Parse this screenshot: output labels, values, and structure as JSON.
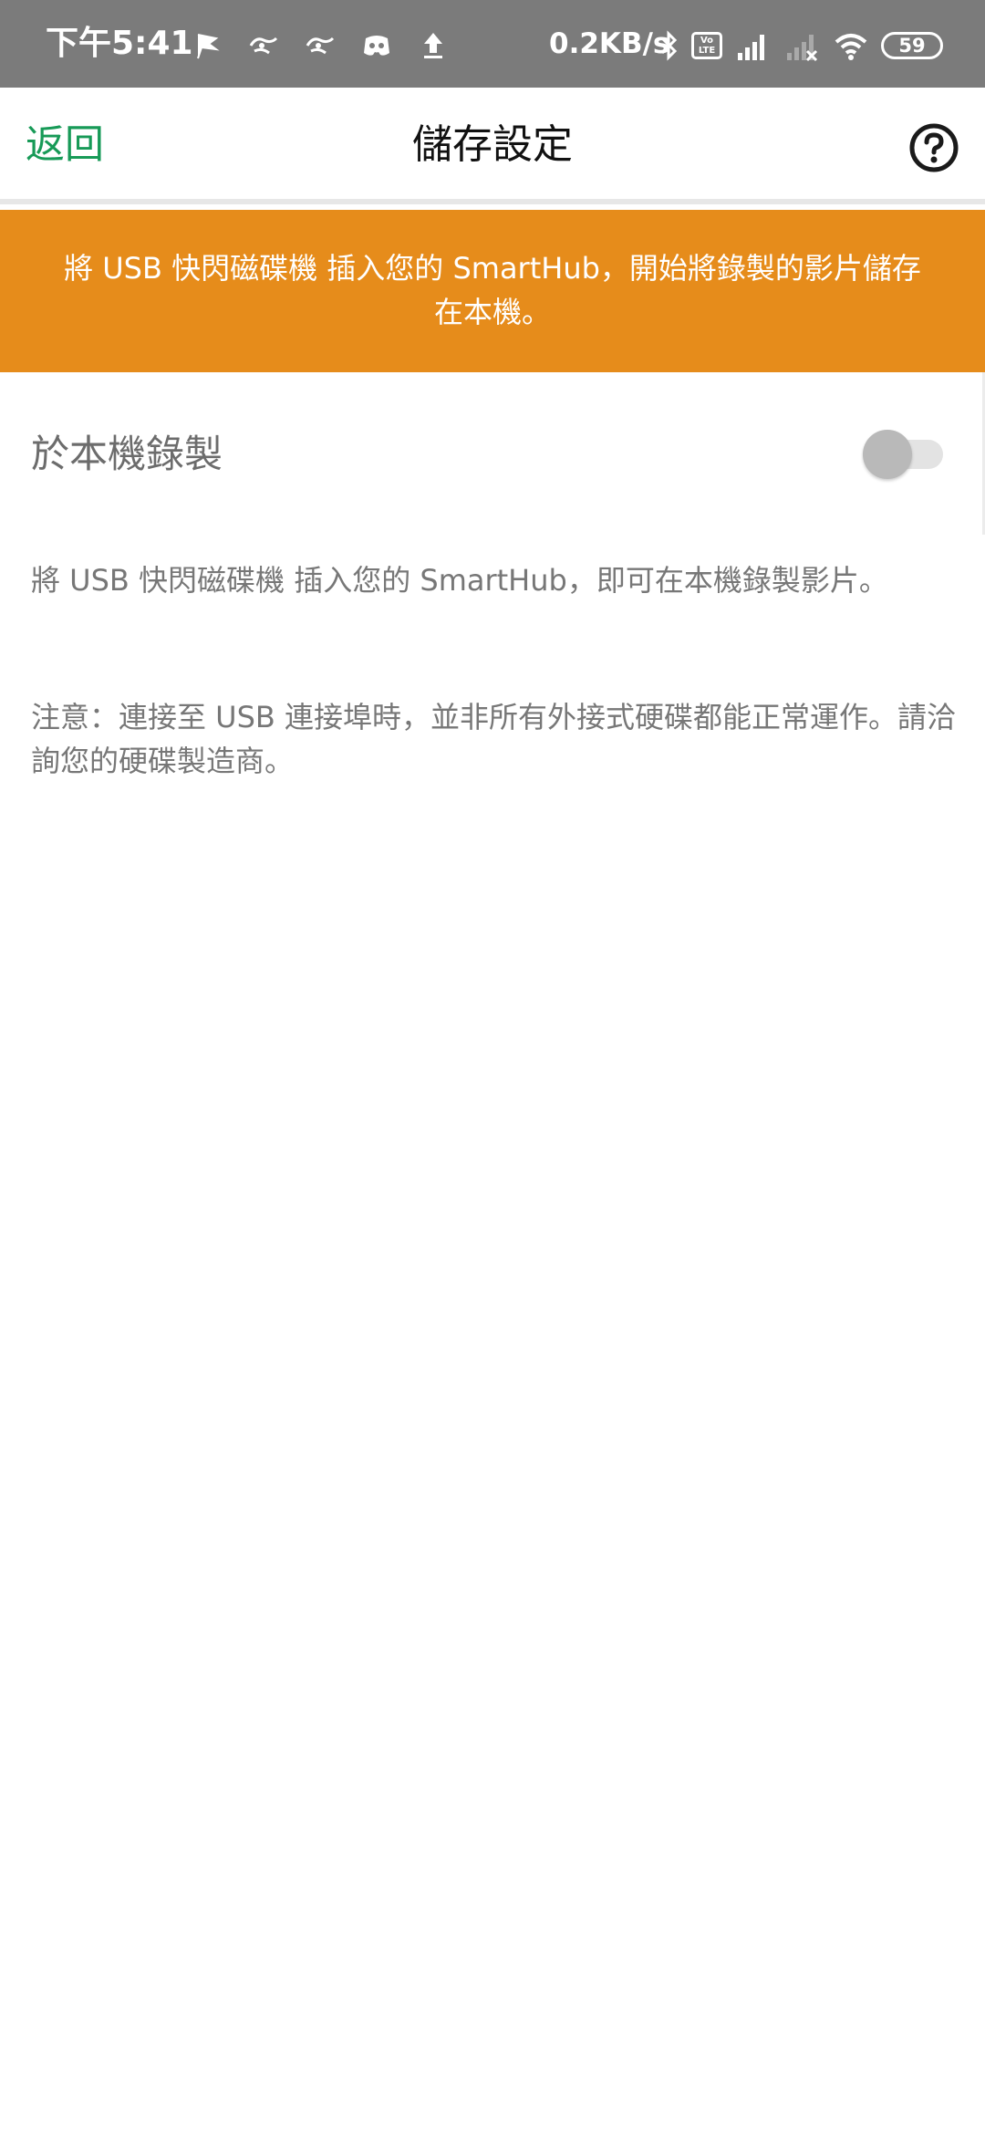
{
  "status_bar": {
    "time": "下午5:41",
    "net_speed": "0.2KB/s",
    "volte_label": "Vo LTE",
    "battery": "59",
    "icons_left": [
      "location-flag-icon",
      "whatsapp-icon",
      "whatsapp-icon",
      "discord-icon",
      "upload-arrow-icon"
    ],
    "icons_right": [
      "bluetooth-icon",
      "volte-icon",
      "signal-icon",
      "signal-no-service-icon",
      "wifi-icon",
      "battery-icon"
    ]
  },
  "header": {
    "back_label": "返回",
    "title": "儲存設定",
    "help_icon": "question-circle-icon"
  },
  "banner": {
    "text": "將 USB 快閃磁碟機 插入您的 SmartHub，開始將錄製的影片儲存在本機。"
  },
  "settings": {
    "local_record_label": "於本機錄製",
    "local_record_enabled": false,
    "description": "將 USB 快閃磁碟機 插入您的 SmartHub，即可在本機錄製影片。",
    "note": "注意：連接至 USB 連接埠時，並非所有外接式硬碟都能正常運作。請洽詢您的硬碟製造商。"
  },
  "colors": {
    "status_bar_bg": "#7b7b7b",
    "accent_green": "#179a57",
    "banner_orange": "#e68c1b",
    "secondary_text": "#777777"
  }
}
